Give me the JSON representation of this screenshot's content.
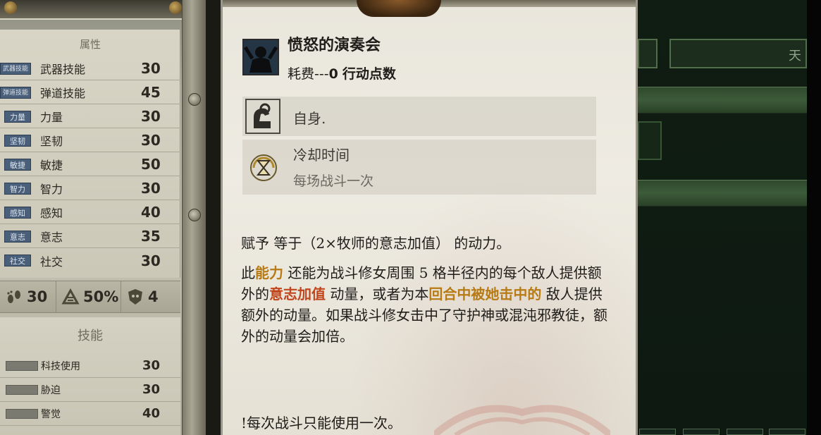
{
  "attributes": {
    "title": "属性",
    "items": [
      {
        "tag": "武器技能",
        "name": "武器技能",
        "value": "30"
      },
      {
        "tag": "弹道技能",
        "name": "弹道技能",
        "value": "45"
      },
      {
        "tag": "力量",
        "name": "力量",
        "value": "30"
      },
      {
        "tag": "坚韧",
        "name": "坚韧",
        "value": "30"
      },
      {
        "tag": "敏捷",
        "name": "敏捷",
        "value": "50"
      },
      {
        "tag": "智力",
        "name": "智力",
        "value": "30"
      },
      {
        "tag": "感知",
        "name": "感知",
        "value": "40"
      },
      {
        "tag": "意志",
        "name": "意志",
        "value": "35"
      },
      {
        "tag": "社交",
        "name": "社交",
        "value": "30"
      }
    ]
  },
  "stats": {
    "movement": "30",
    "dodge": "50%",
    "armor": "4"
  },
  "skills": {
    "title": "技能",
    "items": [
      {
        "name": "科技使用",
        "value": "30"
      },
      {
        "name": "胁迫",
        "value": "30"
      },
      {
        "name": "警觉",
        "value": "40"
      }
    ]
  },
  "tooltip": {
    "title": "愤怒的演奏会",
    "cost_prefix": "耗费---",
    "cost_value": "0",
    "cost_suffix": "行动点数",
    "target": "自身.",
    "cooldown_title": "冷却时间",
    "cooldown_value": "每场战斗一次",
    "description_1": "赋予 等于（2×牧师的意志加值） 的动力。",
    "description_2": {
      "part1": "此",
      "hl1": "能力",
      "part2": " 还能为战斗修女周围 5 格半径内的每个敌人提供额外的",
      "hl2": "意志加值",
      "part3": " 动量，或者为本",
      "hl3": "回合中被她击中的",
      "part4": " 敌人提供额外的动量。如果战斗修女击中了守护神或混沌邪教徒，额外的动量会加倍。"
    },
    "note": "!每次战斗只能使用一次。"
  },
  "right_panel": {
    "header_text": "天"
  },
  "colors": {
    "highlight_gold": "#b87a12",
    "highlight_red": "#c2461c",
    "attr_tag": "#4a5f79",
    "parchment": "#eeebe2"
  },
  "icons": {
    "ability": "screaming-figure-icon",
    "target": "flexed-arm-icon",
    "cooldown": "hourglass-icon",
    "movement": "footsteps-icon",
    "dodge": "dodge-icon",
    "armor": "armor-skull-icon"
  }
}
